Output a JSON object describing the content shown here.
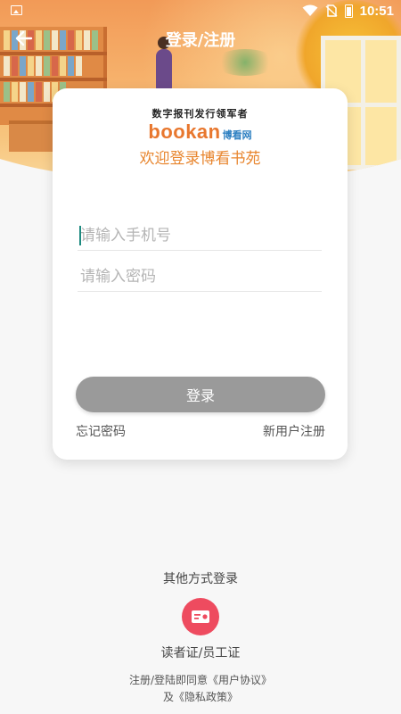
{
  "status_bar": {
    "time": "10:51"
  },
  "header": {
    "title": "登录/注册"
  },
  "brand": {
    "slogan": "数字报刊发行领军者",
    "logo_text": "bookan",
    "logo_cn": "博看网",
    "welcome": "欢迎登录博看书苑"
  },
  "form": {
    "phone_placeholder": "请输入手机号",
    "password_placeholder": "请输入密码",
    "login_label": "登录",
    "forgot_label": "忘记密码",
    "register_label": "新用户注册"
  },
  "other_login": {
    "title": "其他方式登录",
    "reader_card_label": "读者证/员工证"
  },
  "agreement": {
    "prefix": "注册/登陆即同意",
    "user_agreement": "《用户协议》",
    "and": "及",
    "privacy_policy": "《隐私政策》"
  },
  "colors": {
    "accent": "#e8862f",
    "button_disabled": "#9a9a9a",
    "reader_icon_bg": "#ee4b5f"
  },
  "icons": {
    "back": "arrow-left-icon",
    "reader_card": "id-card-icon"
  }
}
